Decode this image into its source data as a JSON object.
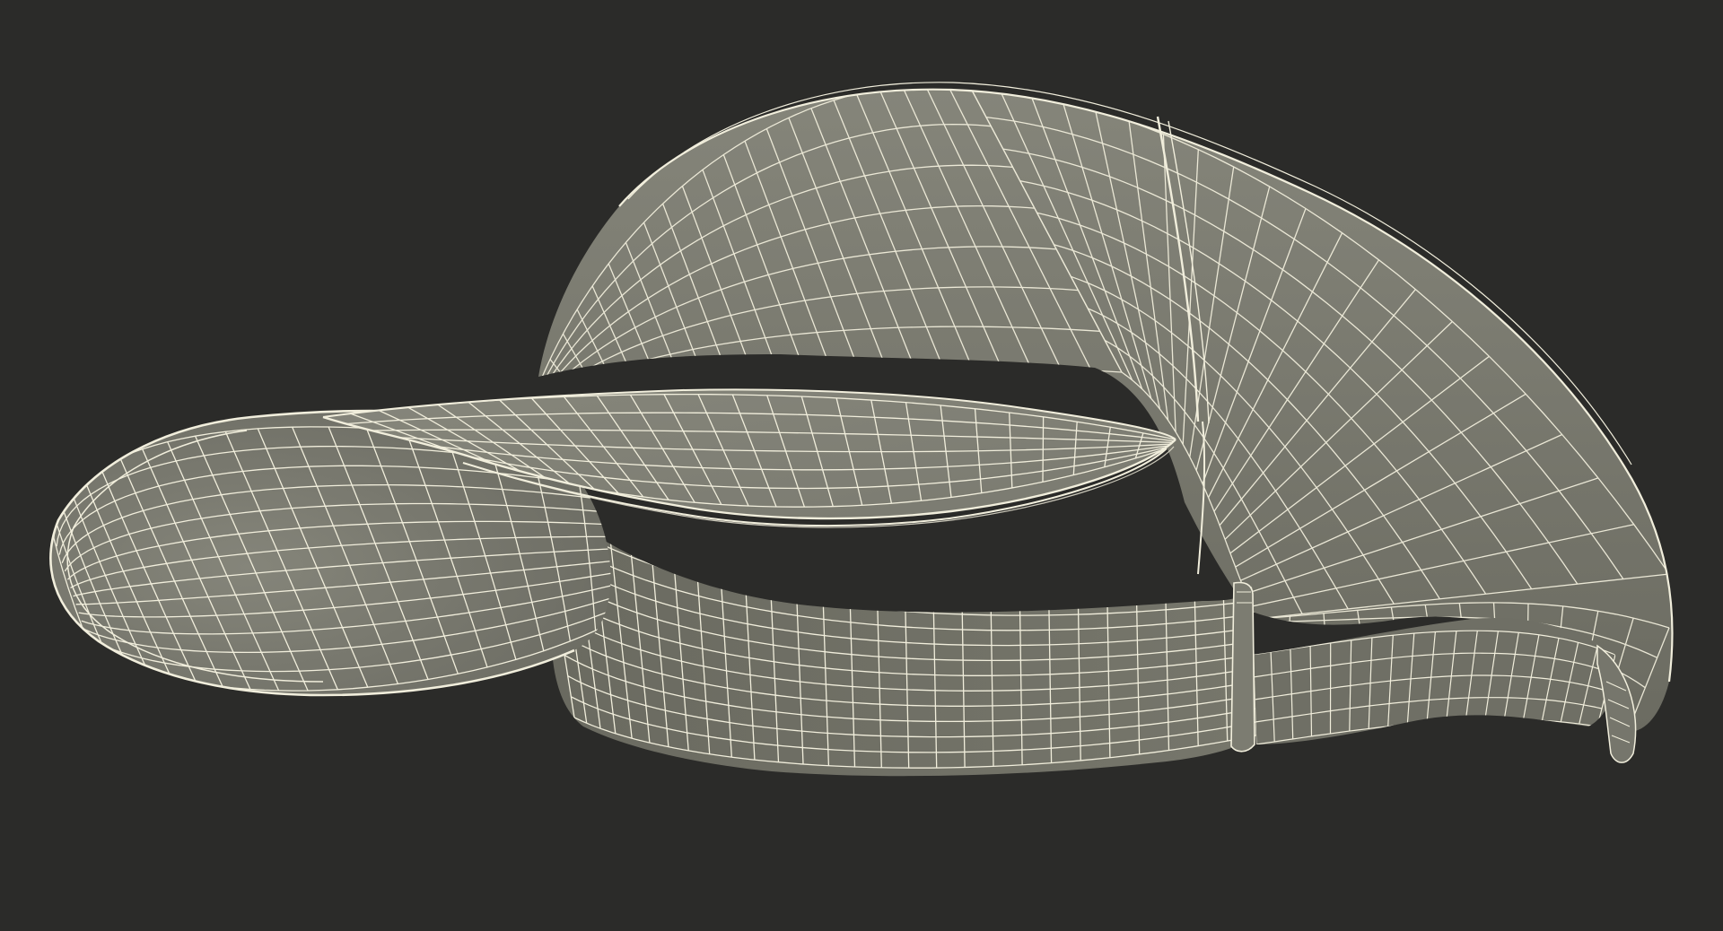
{
  "scene": {
    "subject": "sun-visor-wireframe",
    "background_color": "#2b2b29",
    "surface_color": "#7a7a6d",
    "surface_shadow_color": "#5f5f55",
    "wire_color": "#f1eedc"
  }
}
